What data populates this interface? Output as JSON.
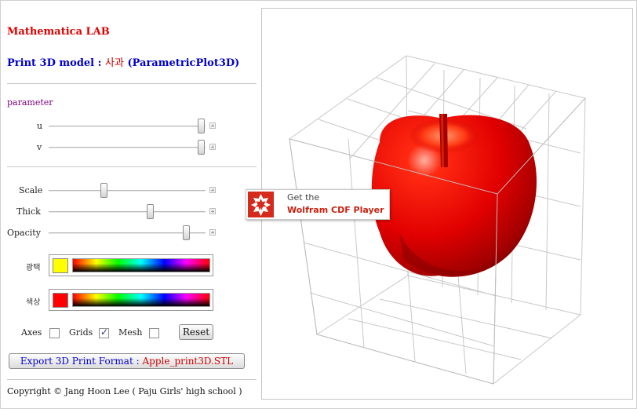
{
  "app": {
    "title": "Mathematica LAB",
    "subtitle_prefix": "Print 3D model :",
    "subtitle_korean": "사과",
    "subtitle_suffix": "(ParametricPlot3D)"
  },
  "parameters": {
    "section_label": "parameter",
    "u": {
      "label": "u",
      "value": 0.98
    },
    "v": {
      "label": "v",
      "value": 0.98
    }
  },
  "controls": {
    "scale": {
      "label": "Scale",
      "value": 0.35
    },
    "thick": {
      "label": "Thick",
      "value": 0.65
    },
    "opacity": {
      "label": "Opacity",
      "value": 0.9
    }
  },
  "colors": {
    "gloss": {
      "label": "광택",
      "swatch": "#ffff00"
    },
    "color": {
      "label": "색상",
      "swatch": "#ff0000"
    }
  },
  "options": {
    "axes": {
      "label": "Axes",
      "checked": false
    },
    "grids": {
      "label": "Grids",
      "checked": true
    },
    "mesh": {
      "label": "Mesh",
      "checked": false
    },
    "reset_label": "Reset"
  },
  "export": {
    "label_prefix": "Export 3D Print Format  :",
    "filename": "Apple_print3D.STL"
  },
  "footer": {
    "copyright": "Copyright © Jang Hoon Lee ( Paju Girls' high school )"
  },
  "cdf_banner": {
    "line1": "Get the",
    "line2": "Wolfram CDF Player",
    "accent": "#c8200e"
  },
  "model": {
    "apple_color": "#ff0000",
    "box_grid": true
  }
}
